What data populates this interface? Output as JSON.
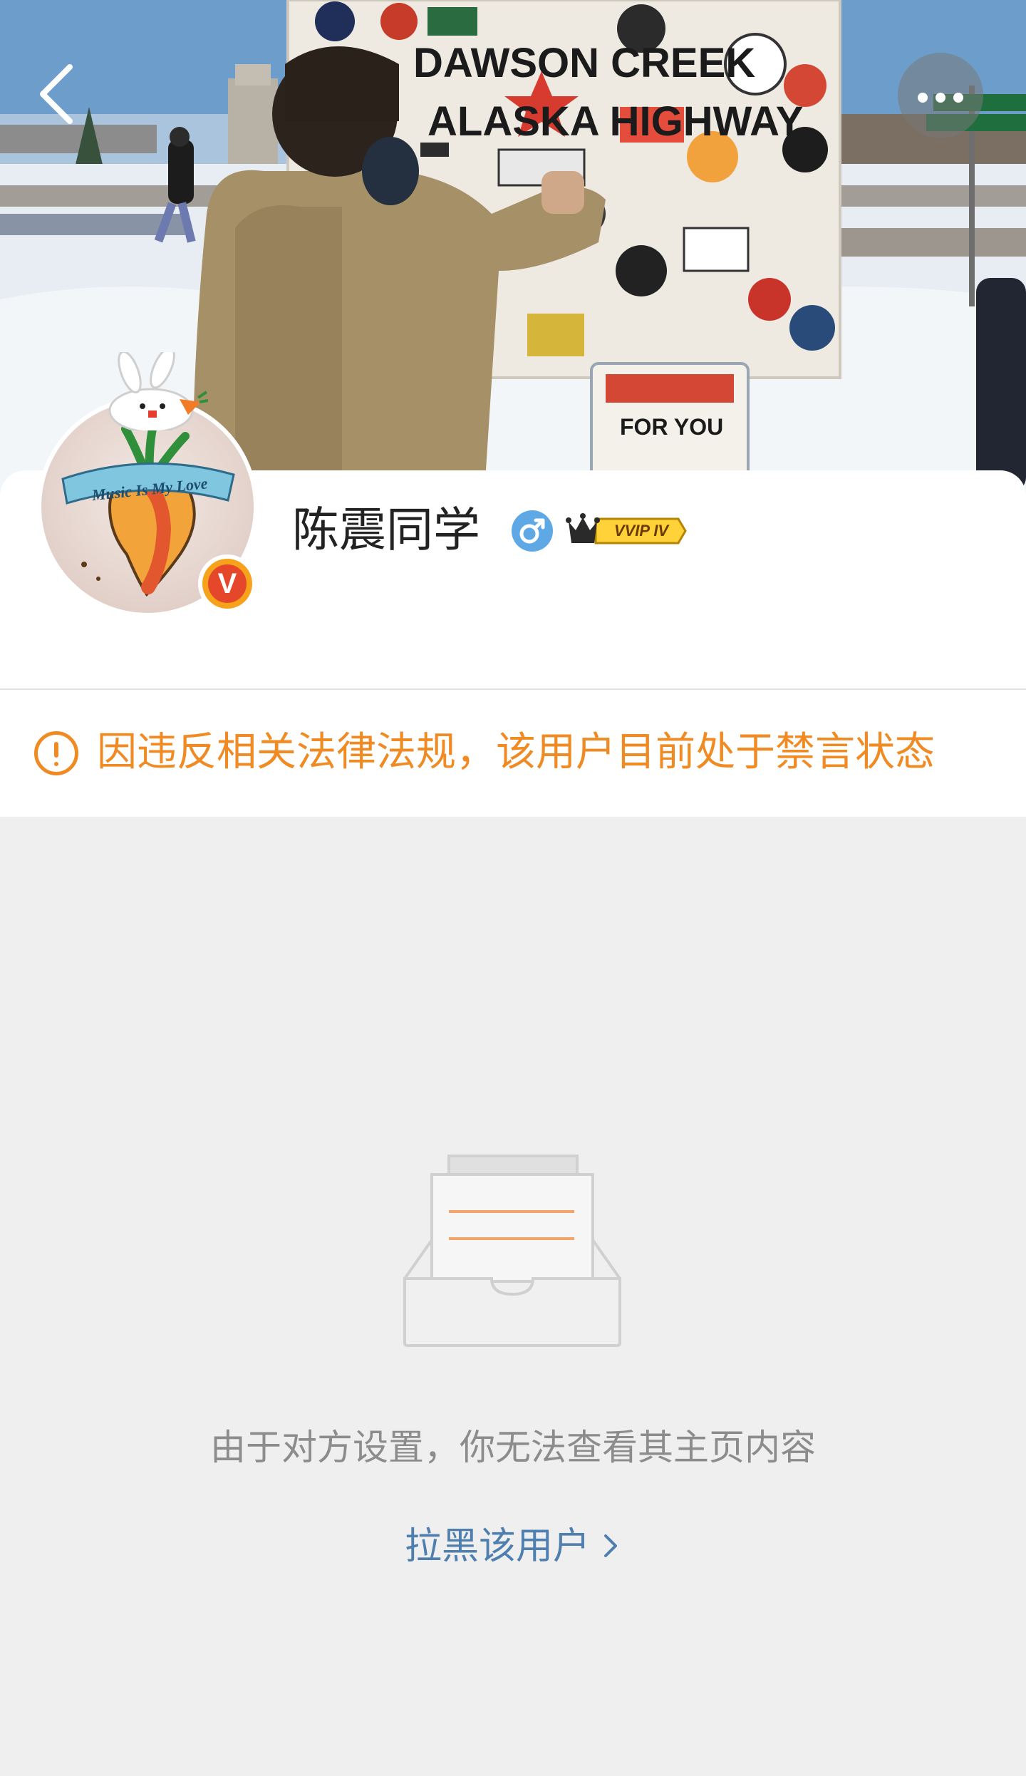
{
  "profile": {
    "name": "陈震同学",
    "gender_icon": "male-icon",
    "vip_label": "VVIP IV",
    "verified_badge": "V",
    "avatar_text": "Music Is My Love"
  },
  "cover": {
    "sign_lines": [
      "DAWSON CREEK",
      "ALASKA HIGHWAY"
    ]
  },
  "nav": {
    "back_icon": "back-arrow-icon",
    "more_icon": "more-dots-icon"
  },
  "notice": {
    "text": "因违反相关法律法规，该用户目前处于禁言状态",
    "color": "#f08a22"
  },
  "empty_state": {
    "message": "由于对方设置，你无法查看其主页内容",
    "link_label": "拉黑该用户",
    "link_color": "#4f7fae"
  }
}
